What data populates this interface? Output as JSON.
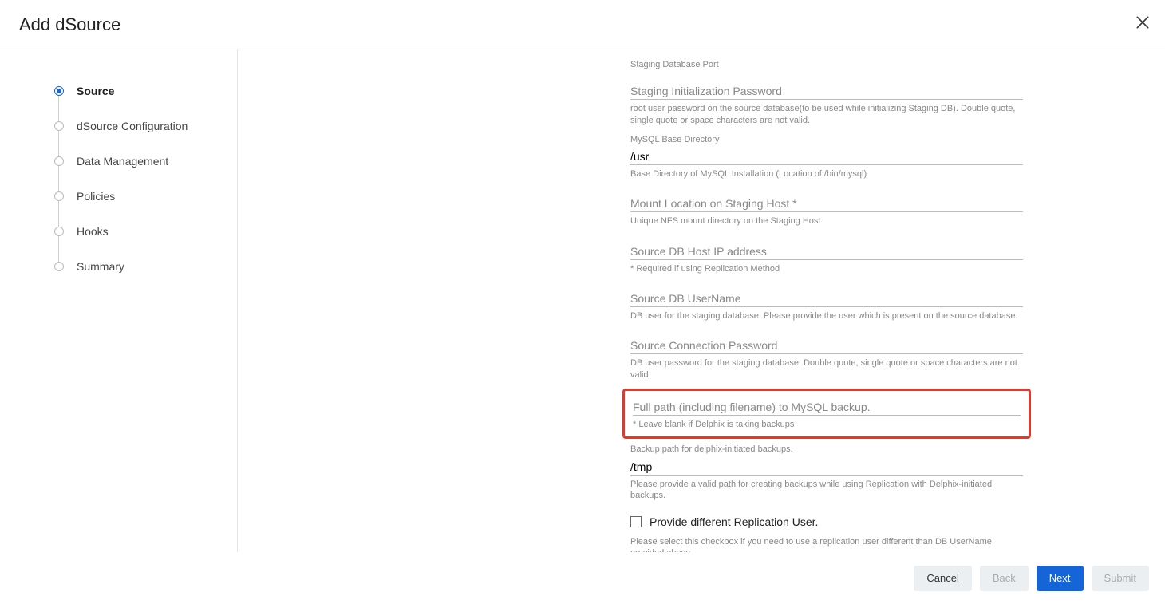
{
  "header": {
    "title": "Add dSource"
  },
  "steps": [
    {
      "label": "Source",
      "active": true
    },
    {
      "label": "dSource Configuration",
      "active": false
    },
    {
      "label": "Data Management",
      "active": false
    },
    {
      "label": "Policies",
      "active": false
    },
    {
      "label": "Hooks",
      "active": false
    },
    {
      "label": "Summary",
      "active": false
    }
  ],
  "form": {
    "stagingPort": {
      "help": "Staging Database Port"
    },
    "stagingInitPwd": {
      "label": "Staging Initialization Password",
      "help": "root user password on the source database(to be used while initializing Staging DB). Double quote, single quote or space characters are not valid."
    },
    "mysqlBase": {
      "label": "MySQL Base Directory",
      "value": "/usr",
      "help": "Base Directory of MySQL Installation (Location of /bin/mysql)"
    },
    "mountLoc": {
      "label": "Mount Location on Staging Host *",
      "help": "Unique NFS mount directory on the Staging Host"
    },
    "sourceIp": {
      "label": "Source DB Host IP address",
      "help": "* Required if using Replication Method"
    },
    "sourceUser": {
      "label": "Source DB UserName",
      "help": "DB user for the staging database. Please provide the user which is present on the source database."
    },
    "sourcePwd": {
      "label": "Source Connection Password",
      "help": "DB user password for the staging database. Double quote, single quote or space characters are not valid."
    },
    "backupPath": {
      "label": "Full path (including filename) to MySQL backup.",
      "help": "* Leave blank if Delphix is taking backups"
    },
    "delphixBackup": {
      "label": "Backup path for delphix-initiated backups.",
      "value": "/tmp",
      "help": "Please provide a valid path for creating backups while using Replication with Delphix-initiated backups."
    },
    "replUser": {
      "label": "Provide different Replication User.",
      "help": "Please select this checkbox if you need to use a replication user different than DB UserName provided above."
    }
  },
  "footer": {
    "cancel": "Cancel",
    "back": "Back",
    "next": "Next",
    "submit": "Submit"
  }
}
